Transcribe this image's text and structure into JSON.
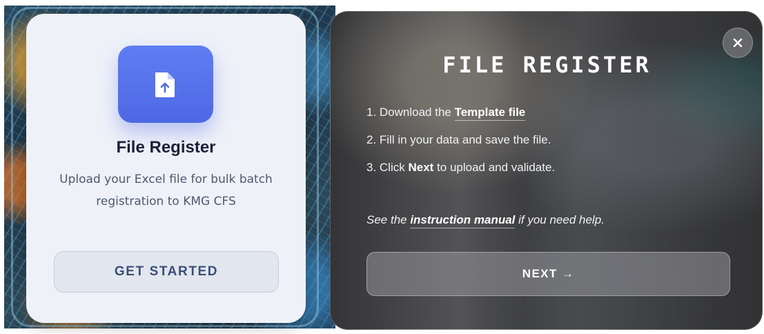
{
  "left_card": {
    "title": "File Register",
    "description": "Upload your Excel file for bulk batch registration to KMG CFS",
    "cta_label": "GET STARTED",
    "icon": "file-upload-icon",
    "tile_color": "#5a78ee"
  },
  "modal": {
    "title": "FILE REGISTER",
    "close_icon": "close-icon",
    "steps": [
      {
        "prefix": "1. Download the ",
        "link": "Template file",
        "suffix": ""
      },
      {
        "text": "2. Fill in your data and save the file."
      },
      {
        "prefix": "3. Click ",
        "bold": "Next",
        "suffix": " to upload and validate."
      }
    ],
    "help": {
      "prefix": "See the ",
      "link": "instruction manual",
      "suffix": " if you need help."
    },
    "next_label": "NEXT →"
  }
}
